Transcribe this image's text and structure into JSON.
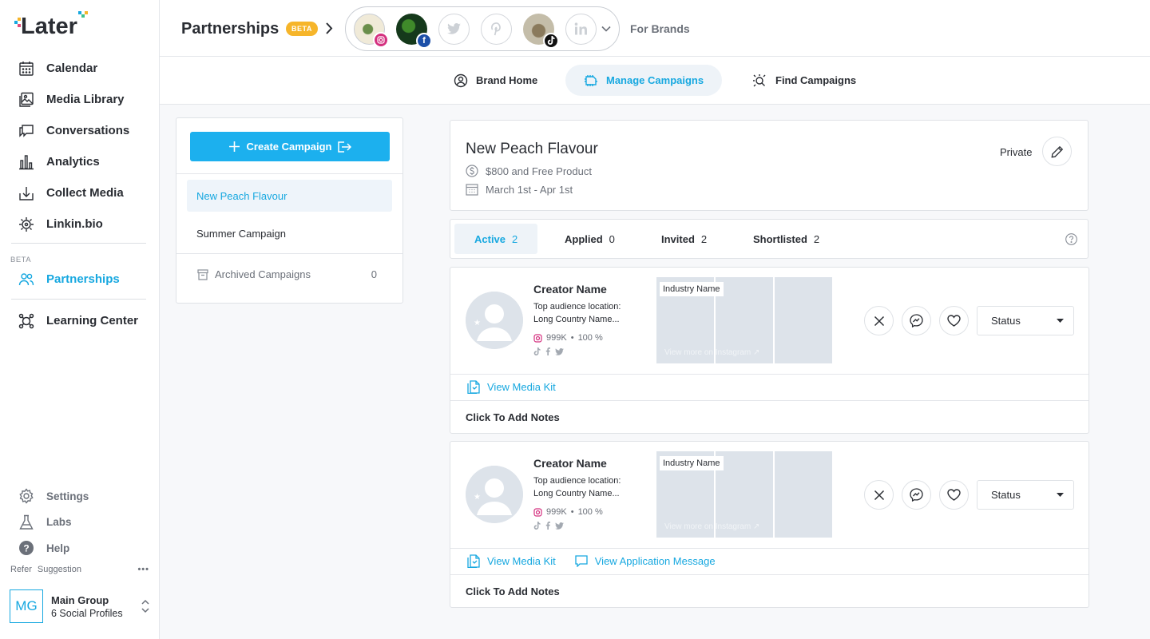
{
  "app": {
    "logo_text": "Later"
  },
  "sidebar": {
    "items": [
      {
        "label": "Calendar",
        "icon": "calendar-icon"
      },
      {
        "label": "Media Library",
        "icon": "media-library-icon"
      },
      {
        "label": "Conversations",
        "icon": "conversations-icon"
      },
      {
        "label": "Analytics",
        "icon": "analytics-icon"
      },
      {
        "label": "Collect Media",
        "icon": "collect-media-icon"
      },
      {
        "label": "Linkin.bio",
        "icon": "linkin-bio-icon"
      }
    ],
    "beta_label": "BETA",
    "partnerships": "Partnerships",
    "learning_center": "Learning Center",
    "bottom": {
      "settings": "Settings",
      "labs": "Labs",
      "help": "Help"
    },
    "refer": "Refer",
    "suggestion": "Suggestion",
    "more": "•••",
    "account": {
      "initials": "MG",
      "name": "Main Group",
      "profiles": "6 Social Profiles"
    }
  },
  "header": {
    "title": "Partnerships",
    "beta": "BETA",
    "for_brands": "For Brands",
    "profile_badges": {
      "instagram": "instagram-icon",
      "facebook": "f",
      "tiktok": "tiktok-icon"
    }
  },
  "subtabs": {
    "brand_home": "Brand Home",
    "manage": "Manage Campaigns",
    "find": "Find Campaigns"
  },
  "campaign_list": {
    "create_label": "Create Campaign",
    "items": [
      "New Peach Flavour",
      "Summer Campaign"
    ],
    "archived_label": "Archived Campaigns",
    "archived_count": "0"
  },
  "campaign": {
    "title": "New Peach Flavour",
    "compensation": "$800 and Free Product",
    "dates": "March 1st - Apr 1st",
    "visibility": "Private"
  },
  "status_tabs": [
    {
      "label": "Active",
      "count": "2"
    },
    {
      "label": "Applied",
      "count": "0"
    },
    {
      "label": "Invited",
      "count": "2"
    },
    {
      "label": "Shortlisted",
      "count": "2"
    }
  ],
  "creators": [
    {
      "name": "Creator Name",
      "loc_title": "Top audience location:",
      "loc_value": "Long Country Name...",
      "followers": "999K",
      "engagement": "100 %",
      "industry": "Industry Name",
      "view_more": "View more on Instagram ↗",
      "status": "Status",
      "media_kit": "View Media Kit",
      "notes": "Click To Add Notes"
    },
    {
      "name": "Creator Name",
      "loc_title": "Top audience location:",
      "loc_value": "Long Country Name...",
      "followers": "999K",
      "engagement": "100 %",
      "industry": "Industry Name",
      "view_more": "View more on Instagram ↗",
      "status": "Status",
      "media_kit": "View Media Kit",
      "app_message": "View Application Message",
      "notes": "Click To Add Notes"
    }
  ],
  "colors": {
    "accent": "#17a8e0",
    "button": "#1cb0ee",
    "beta": "#f6b52a",
    "instagram": "#d4307f",
    "facebook": "#1c4fa8"
  }
}
